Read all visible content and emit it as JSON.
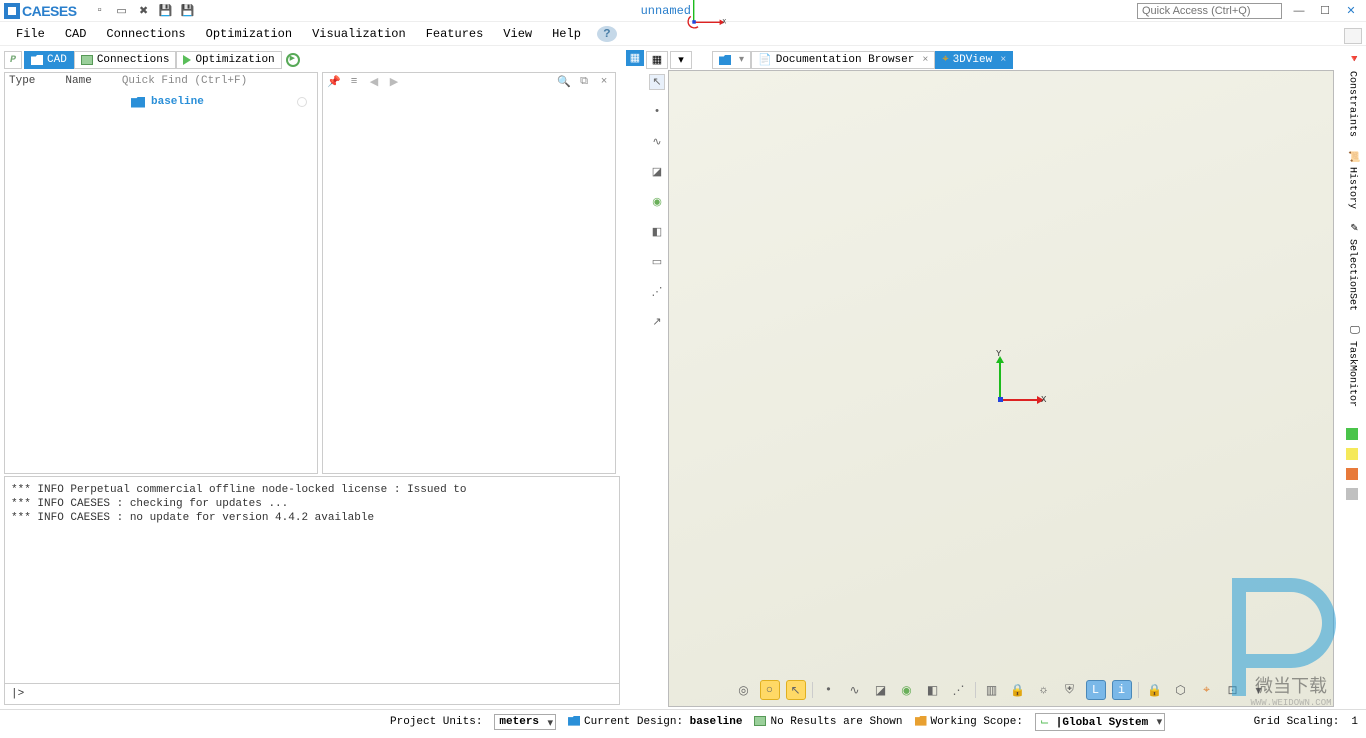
{
  "app": {
    "name": "CAESES",
    "title": "unnamed",
    "quick_access_ph": "Quick Access (Ctrl+Q)"
  },
  "menus": [
    "File",
    "CAD",
    "Connections",
    "Optimization",
    "Visualization",
    "Features",
    "View",
    "Help"
  ],
  "left_tabs": {
    "cad": "CAD",
    "connections": "Connections",
    "optimization": "Optimization"
  },
  "tree": {
    "col_type": "Type",
    "col_name": "Name",
    "quickfind_ph": "Quick Find (Ctrl+F)",
    "item": "baseline"
  },
  "console": {
    "l1": "*** INFO Perpetual commercial offline node-locked license : Issued to",
    "l2": "*** INFO CAESES : checking for updates ...",
    "l3": "*** INFO CAESES : no update for version 4.4.2 available",
    "prompt": "|>"
  },
  "view_tabs": {
    "doc": "Documentation Browser",
    "view3d": "3DView"
  },
  "axes": {
    "x": "X",
    "y": "Y"
  },
  "right_strip": [
    "Constraints",
    "History",
    "SelectionSet",
    "TaskMonitor"
  ],
  "status": {
    "units_label": "Project Units:",
    "units_val": "meters",
    "design_label": "Current Design:",
    "design_val": "baseline",
    "results": "No Results are Shown",
    "scope_label": "Working Scope:",
    "coord_val": "|Global System",
    "grid_label": "Grid Scaling:",
    "grid_val": "1"
  },
  "watermark": {
    "text": "微当下载",
    "url": "WWW.WEIDOWN.COM"
  }
}
